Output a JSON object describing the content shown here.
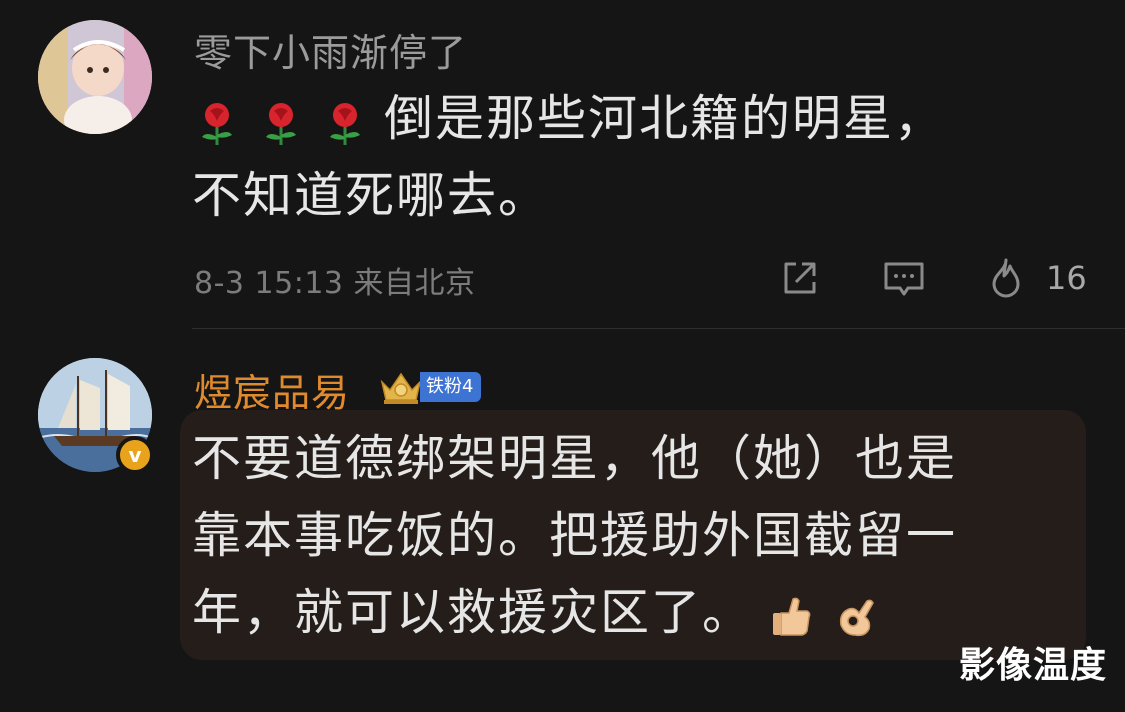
{
  "comments": [
    {
      "username": "零下小雨渐停了",
      "emojis": [
        "rose-emoji",
        "rose-emoji",
        "rose-emoji"
      ],
      "text": "倒是那些河北籍的明星，\n不知道死哪去。",
      "meta": "8-3 15:13 来自北京",
      "like_count": "16",
      "icons": {
        "share": "share-icon",
        "reply": "comment-icon",
        "like": "flame-icon"
      }
    },
    {
      "username": "煜宸品易",
      "badge_label": "铁粉4",
      "verified_label": "v",
      "text": "不要道德绑架明星，他（她）也是\n靠本事吃饭的。把援助外国截留一\n年，就可以救援灾区了。",
      "trailing_emojis": [
        "thumbs-up-emoji",
        "ok-hand-emoji"
      ]
    }
  ],
  "watermark": "影像温度",
  "colors": {
    "background": "#151515",
    "username_primary": "#9b9b9b",
    "username_highlight": "#e08a2e",
    "bubble": "#241d1a",
    "badge": "#3d74d4",
    "verified": "#e8a21b"
  }
}
